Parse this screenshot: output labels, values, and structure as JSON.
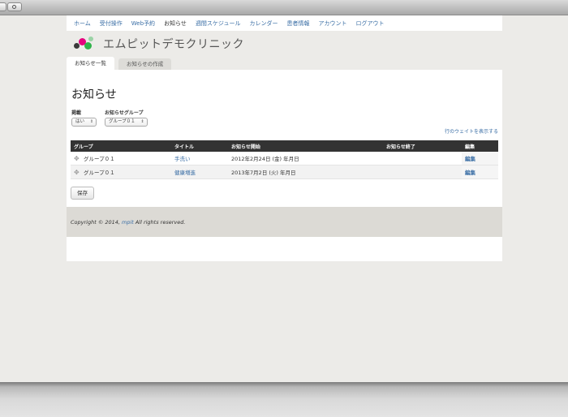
{
  "nav": {
    "items": [
      {
        "label": "ホーム"
      },
      {
        "label": "受付操作"
      },
      {
        "label": "Web予約"
      },
      {
        "label": "お知らせ"
      },
      {
        "label": "週間スケジュール"
      },
      {
        "label": "カレンダー"
      },
      {
        "label": "患者情報"
      },
      {
        "label": "アカウント"
      },
      {
        "label": "ログアウト"
      }
    ]
  },
  "brand": {
    "site_name": "エムピットデモクリニック",
    "logo_colors": [
      "#3a3a3a",
      "#e6007e",
      "#2fb34a",
      "#9bd3a6"
    ]
  },
  "tabs": [
    {
      "label": "お知らせ一覧"
    },
    {
      "label": "お知らせの作成"
    }
  ],
  "page": {
    "title": "お知らせ",
    "filter_published_label": "掲載",
    "filter_published_value": "はい",
    "filter_group_label": "お知らせグループ",
    "filter_group_value": "グループ０１",
    "weight_link": "行のウェイトを表示する",
    "save_label": "保存"
  },
  "table": {
    "headers": [
      "グループ",
      "タイトル",
      "お知らせ開始",
      "お知らせ終了",
      "編集"
    ],
    "rows": [
      {
        "group": "グループ０１",
        "title": "手洗い",
        "start": "2012年2月24日 (金) 年月日",
        "end": "",
        "edit": "編集"
      },
      {
        "group": "グループ０１",
        "title": "健康増進",
        "start": "2013年7月2日 (火) 年月日",
        "end": "",
        "edit": "編集"
      }
    ]
  },
  "footer": {
    "prefix": "Copyright © 2014,",
    "link": "mpit",
    "suffix": "All rights reserved."
  }
}
